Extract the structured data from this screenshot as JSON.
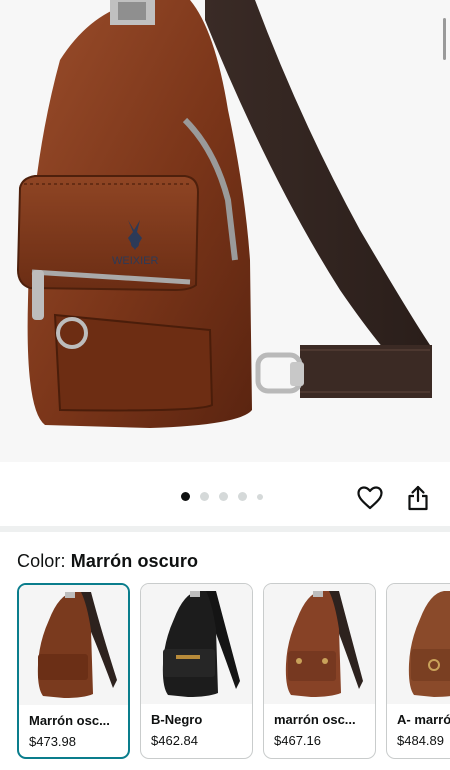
{
  "product": {
    "brand_mark": "WEIXIER",
    "image_alt": "Bolso bandolera de cuero marrón"
  },
  "gallery": {
    "dot_count": 5,
    "active_index": 0
  },
  "icons": {
    "wishlist": "heart-icon",
    "share": "share-icon"
  },
  "color_selector": {
    "label": "Color:",
    "selected": "Marrón oscuro",
    "options": [
      {
        "name": "Marrón osc...",
        "price": "$473.98",
        "color": "#7a3a1e"
      },
      {
        "name": "B-Negro",
        "price": "$462.84",
        "color": "#1c1c1c"
      },
      {
        "name": "marrón osc...",
        "price": "$467.16",
        "color": "#874226"
      },
      {
        "name": "A- marró",
        "price": "$484.89",
        "color": "#8a4a2a"
      }
    ]
  },
  "colors": {
    "accent_teal": "#0a7d8c",
    "leather": "#7b3b20"
  }
}
